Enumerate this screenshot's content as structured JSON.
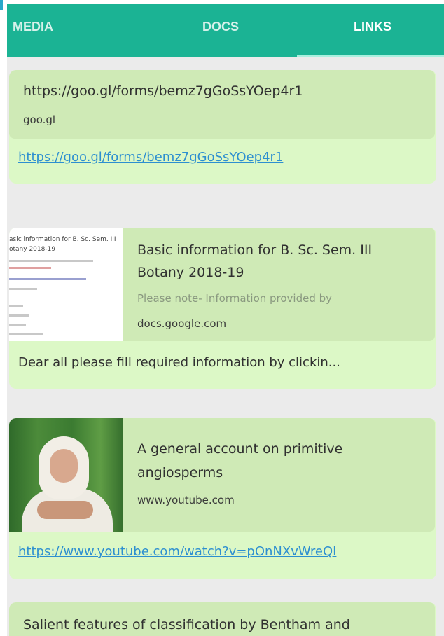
{
  "tabs": [
    {
      "label": "MEDIA",
      "active": false
    },
    {
      "label": "DOCS",
      "active": false
    },
    {
      "label": "LINKS",
      "active": true
    }
  ],
  "colors": {
    "tabbar": "#1bb394",
    "card": "#dcf8c6",
    "link": "#2d8fd0",
    "background": "#ebebeb"
  },
  "links": [
    {
      "title": "https://goo.gl/forms/bemz7gGoSsYOep4r1",
      "domain": "goo.gl",
      "url": "https://goo.gl/forms/bemz7gGoSsYOep4r1"
    },
    {
      "title_line1": "Basic information for B. Sc. Sem. III",
      "title_line2": "Botany 2018-19",
      "description": "Please note- Information provided by",
      "domain": "docs.google.com",
      "message": "Dear all please fill required information by clickin...",
      "thumbnail": {
        "heading1": "asic information for B. Sc. Sem. III",
        "heading2": "otany 2018-19"
      }
    },
    {
      "title_line1": "A general account on primitive",
      "title_line2": "angiosperms",
      "domain": "www.youtube.com",
      "url": "https://www.youtube.com/watch?v=pOnNXvWreQI"
    },
    {
      "title": "Salient features of classification by Bentham and"
    }
  ]
}
